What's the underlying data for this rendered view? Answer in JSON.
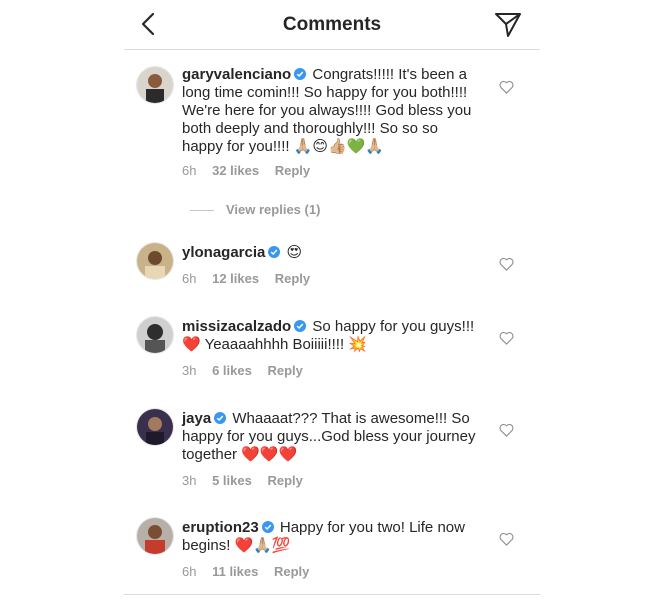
{
  "header": {
    "title": "Comments",
    "back_icon": "chevron-left-icon",
    "send_icon": "paper-plane-icon"
  },
  "comments": [
    {
      "username": "garyvalenciano",
      "verified": true,
      "text": "Congrats!!!!! It's been a long time comin!!! So happy for you both!!!! We're here for you always!!!! God bless you both deeply and thoroughly!!! So so so happy for you!!!! 🙏🏼😊👍🏼💚🙏🏼",
      "time": "6h",
      "likes": "32 likes",
      "reply": "Reply"
    },
    {
      "username": "ylonagarcia",
      "verified": true,
      "text": "😍",
      "time": "6h",
      "likes": "12 likes",
      "reply": "Reply"
    },
    {
      "username": "missizacalzado",
      "verified": true,
      "text": "So happy for you guys!!! ❤️ Yeaaaahhhh Boiiiii!!!! 💥",
      "time": "3h",
      "likes": "6 likes",
      "reply": "Reply"
    },
    {
      "username": "jaya",
      "verified": true,
      "text": "Whaaaat??? That is awesome!!! So happy for you guys...God bless your journey together ❤️❤️❤️",
      "time": "3h",
      "likes": "5 likes",
      "reply": "Reply"
    },
    {
      "username": "eruption23",
      "verified": true,
      "text": "Happy for you two! Life now begins! ❤️🙏🏼💯",
      "time": "6h",
      "likes": "11 likes",
      "reply": "Reply"
    }
  ],
  "view_replies": "View replies (1)",
  "colors": {
    "verified": "#3897f0",
    "muted": "#999999",
    "text": "#262626",
    "divider": "#dbdbdb"
  }
}
